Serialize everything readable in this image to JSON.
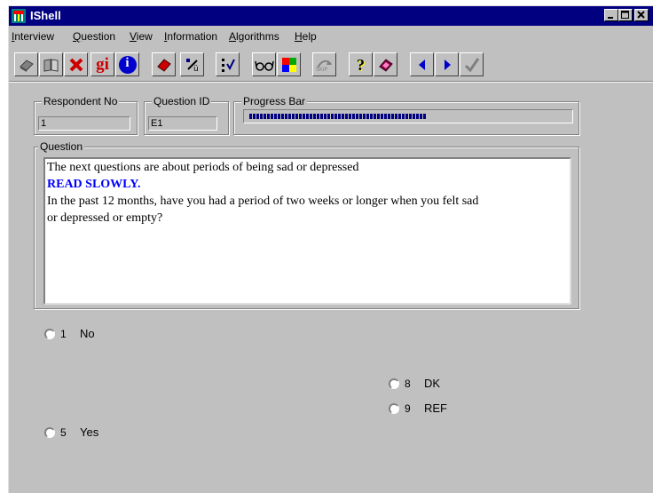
{
  "window": {
    "title": "IShell"
  },
  "menu": [
    {
      "label": "Interview",
      "underline": "I",
      "rest": "nterview"
    },
    {
      "label": "Question",
      "underline": "Q",
      "rest": "uestion"
    },
    {
      "label": "View",
      "underline": "V",
      "rest": "iew"
    },
    {
      "label": "Information",
      "underline": "I",
      "rest": "nformation"
    },
    {
      "label": "Algorithms",
      "underline": "A",
      "rest": "lgorithms"
    },
    {
      "label": "Help",
      "underline": "H",
      "rest": "elp"
    }
  ],
  "toolbar": {
    "icons": [
      "book-icon",
      "open-book-icon",
      "delete-x-icon",
      "gi-icon",
      "info-icon",
      "eraser-icon",
      "percent-icon",
      "checklist-icon",
      "glasses-icon",
      "color-grid-icon",
      "skip-icon",
      "help-icon",
      "bookmark-icon",
      "previous-arrow-icon",
      "next-arrow-icon",
      "checkmark-icon"
    ],
    "gi_label": "gi",
    "info_label": "i",
    "help_label": "?",
    "skip_label": "SKIP"
  },
  "respondent": {
    "label": "Respondent No",
    "value": "1"
  },
  "question_id": {
    "label": "Question ID",
    "value": "E1"
  },
  "progress": {
    "label": "Progress Bar",
    "fraction": 0.56
  },
  "question": {
    "label": "Question",
    "lines": [
      " The next questions are about periods of being sad or depressed",
      "READ SLOWLY.",
      "In the past 12 months, have you had a period of two weeks or longer when you felt sad",
      "or depressed or empty?"
    ]
  },
  "options": [
    {
      "code": "1",
      "label": "No"
    },
    {
      "code": "8",
      "label": "DK"
    },
    {
      "code": "9",
      "label": "REF"
    },
    {
      "code": "5",
      "label": "Yes"
    }
  ],
  "colors": {
    "titlebar": "#000080",
    "emphasis": "#0000ff",
    "face": "#c0c0c0"
  }
}
